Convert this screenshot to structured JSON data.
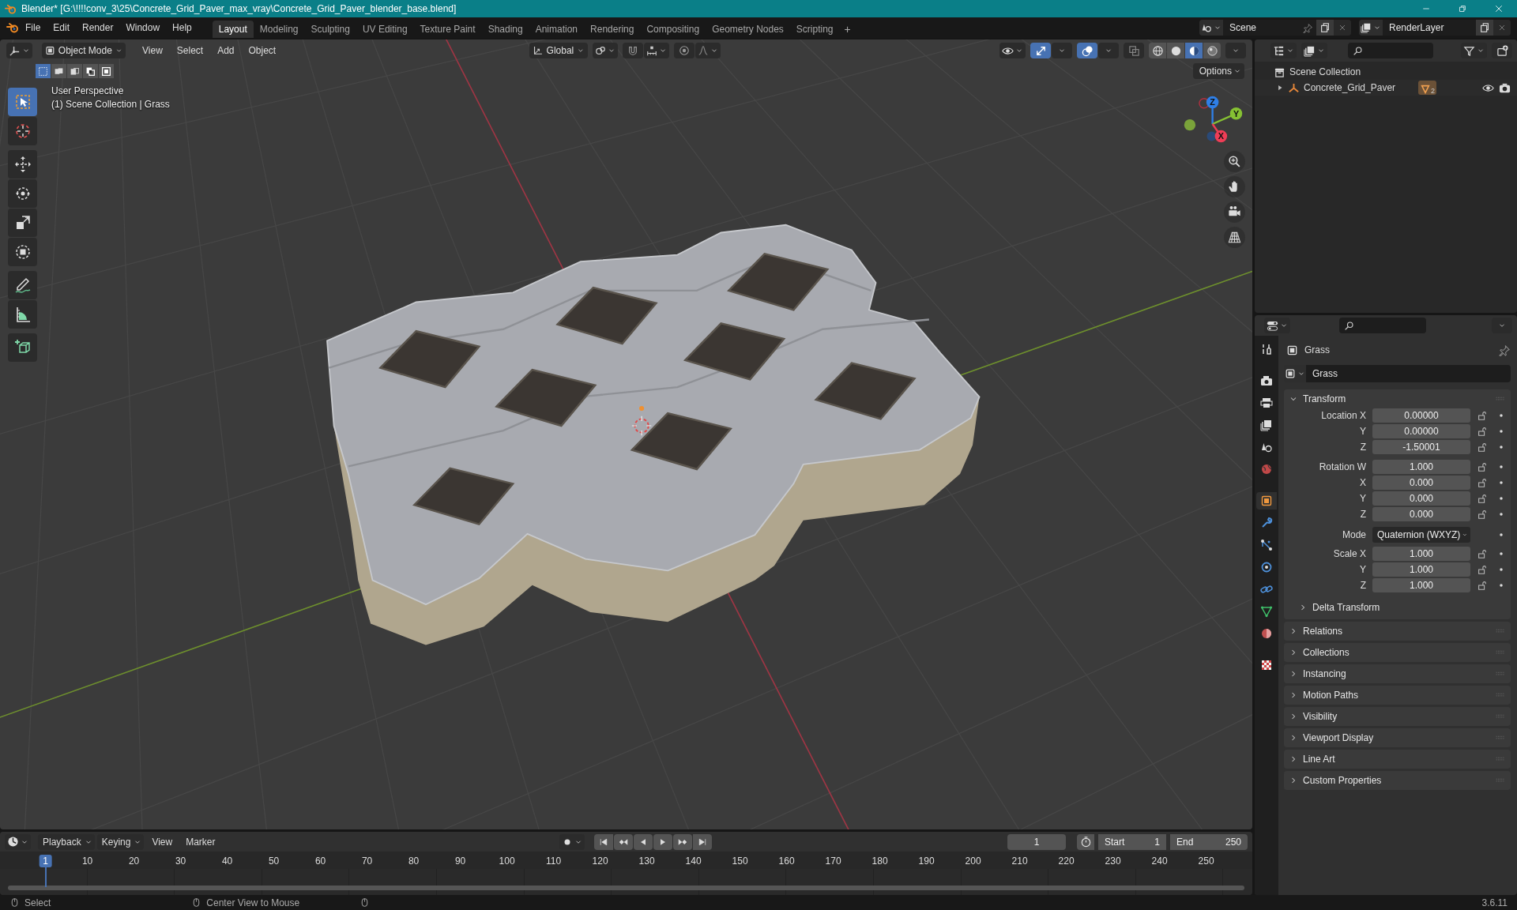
{
  "window": {
    "title": "Blender* [G:\\!!!!conv_3\\25\\Concrete_Grid_Paver_max_vray\\Concrete_Grid_Paver_blender_base.blend]"
  },
  "menu": [
    "File",
    "Edit",
    "Render",
    "Window",
    "Help"
  ],
  "workspaces": [
    {
      "label": "Layout",
      "selected": true
    },
    {
      "label": "Modeling",
      "selected": false
    },
    {
      "label": "Sculpting",
      "selected": false
    },
    {
      "label": "UV Editing",
      "selected": false
    },
    {
      "label": "Texture Paint",
      "selected": false
    },
    {
      "label": "Shading",
      "selected": false
    },
    {
      "label": "Animation",
      "selected": false
    },
    {
      "label": "Rendering",
      "selected": false
    },
    {
      "label": "Compositing",
      "selected": false
    },
    {
      "label": "Geometry Nodes",
      "selected": false
    },
    {
      "label": "Scripting",
      "selected": false
    }
  ],
  "add_workspace": "+",
  "scene": "Scene",
  "view_layer": "RenderLayer",
  "viewport": {
    "mode": "Object Mode",
    "menus": [
      "View",
      "Select",
      "Add",
      "Object"
    ],
    "orientation": "Global",
    "select_modes": [
      {
        "selected": true
      },
      {
        "selected": false
      },
      {
        "selected": false
      },
      {
        "selected": false
      },
      {
        "selected": false
      }
    ],
    "gizmos": {
      "on": true
    },
    "overlays": {
      "on": true
    },
    "xray": {
      "on": false
    },
    "shading": [
      {
        "selected": false
      },
      {
        "selected": false
      },
      {
        "selected": true
      },
      {
        "selected": false
      }
    ],
    "options": "Options",
    "info": [
      "User Perspective",
      "(1) Scene Collection | Grass"
    ],
    "tools": [
      {
        "selected": true
      },
      {
        "selected": false
      },
      {
        "selected": false
      },
      {
        "selected": false
      },
      {
        "selected": false
      },
      {
        "selected": false
      },
      {
        "selected": false
      },
      {
        "selected": false
      },
      {
        "selected": false
      }
    ],
    "gizmo": {
      "axes": [
        "Z",
        "Y",
        "X"
      ]
    }
  },
  "outliner": {
    "root": "Scene Collection",
    "items": [
      {
        "label": "Concrete_Grid_Paver",
        "expanded": false,
        "data_count": "2"
      }
    ]
  },
  "properties": {
    "tabs": [
      {
        "selected": false
      },
      {
        "selected": false
      },
      {
        "selected": false
      },
      {
        "selected": false
      },
      {
        "selected": false
      },
      {
        "selected": false
      },
      {
        "selected": true
      },
      {
        "selected": false
      },
      {
        "selected": false
      },
      {
        "selected": false
      },
      {
        "selected": false
      },
      {
        "selected": false
      },
      {
        "selected": false
      },
      {
        "selected": false
      }
    ],
    "object": "Grass",
    "name_field": "Grass",
    "panels": [
      {
        "title": "Transform",
        "expanded": true,
        "groups": [
          {
            "rows": [
              {
                "label": "Location X",
                "value": "0.00000",
                "kind": "number"
              },
              {
                "label": "Y",
                "value": "0.00000",
                "kind": "number"
              },
              {
                "label": "Z",
                "value": "-1.50001",
                "kind": "number"
              }
            ]
          },
          {
            "rows": [
              {
                "label": "Rotation W",
                "value": "1.000",
                "kind": "number"
              },
              {
                "label": "X",
                "value": "0.000",
                "kind": "number"
              },
              {
                "label": "Y",
                "value": "0.000",
                "kind": "number"
              },
              {
                "label": "Z",
                "value": "0.000",
                "kind": "number"
              }
            ]
          },
          {
            "rows": [
              {
                "label": "Mode",
                "value": "Quaternion (WXYZ)",
                "kind": "dropdown"
              }
            ]
          },
          {
            "rows": [
              {
                "label": "Scale X",
                "value": "1.000",
                "kind": "number"
              },
              {
                "label": "Y",
                "value": "1.000",
                "kind": "number"
              },
              {
                "label": "Z",
                "value": "1.000",
                "kind": "number"
              }
            ]
          }
        ],
        "subpanels": [
          {
            "title": "Delta Transform",
            "expanded": false
          }
        ]
      },
      {
        "title": "Relations",
        "expanded": false
      },
      {
        "title": "Collections",
        "expanded": false
      },
      {
        "title": "Instancing",
        "expanded": false
      },
      {
        "title": "Motion Paths",
        "expanded": false
      },
      {
        "title": "Visibility",
        "expanded": false
      },
      {
        "title": "Viewport Display",
        "expanded": false
      },
      {
        "title": "Line Art",
        "expanded": false
      },
      {
        "title": "Custom Properties",
        "expanded": false
      }
    ]
  },
  "timeline": {
    "menus": [
      "Playback",
      "Keying",
      "View",
      "Marker"
    ],
    "current_frame": "1",
    "start": {
      "label": "Start",
      "value": "1"
    },
    "end": {
      "label": "End",
      "value": "250"
    },
    "ruler": [
      {
        "label": "1",
        "selected": true
      },
      {
        "label": "10",
        "selected": false
      },
      {
        "label": "20",
        "selected": false
      },
      {
        "label": "30",
        "selected": false
      },
      {
        "label": "40",
        "selected": false
      },
      {
        "label": "50",
        "selected": false
      },
      {
        "label": "60",
        "selected": false
      },
      {
        "label": "70",
        "selected": false
      },
      {
        "label": "80",
        "selected": false
      },
      {
        "label": "90",
        "selected": false
      },
      {
        "label": "100",
        "selected": false
      },
      {
        "label": "110",
        "selected": false
      },
      {
        "label": "120",
        "selected": false
      },
      {
        "label": "130",
        "selected": false
      },
      {
        "label": "140",
        "selected": false
      },
      {
        "label": "150",
        "selected": false
      },
      {
        "label": "160",
        "selected": false
      },
      {
        "label": "170",
        "selected": false
      },
      {
        "label": "180",
        "selected": false
      },
      {
        "label": "190",
        "selected": false
      },
      {
        "label": "200",
        "selected": false
      },
      {
        "label": "210",
        "selected": false
      },
      {
        "label": "220",
        "selected": false
      },
      {
        "label": "230",
        "selected": false
      },
      {
        "label": "240",
        "selected": false
      },
      {
        "label": "250",
        "selected": false
      }
    ]
  },
  "status": {
    "hints": [
      "Select",
      "Center View to Mouse"
    ],
    "version": "3.6.11"
  }
}
